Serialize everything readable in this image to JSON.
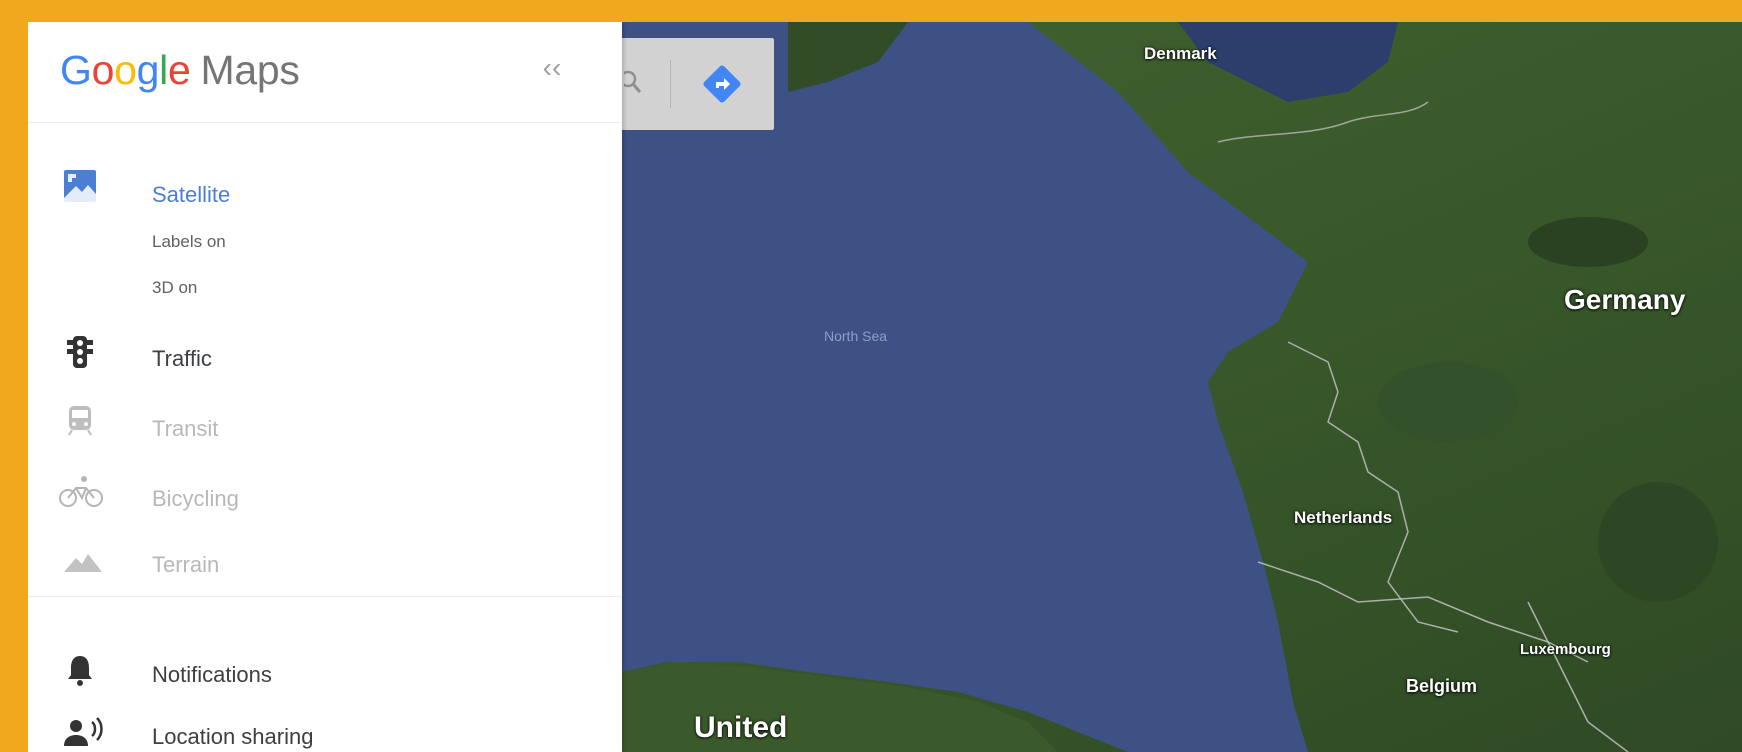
{
  "app": {
    "logo": {
      "letters": [
        "G",
        "o",
        "o",
        "g",
        "l",
        "e"
      ],
      "suffix": "Maps"
    },
    "collapse_label": "‹‹"
  },
  "panel": {
    "satellite": {
      "label": "Satellite",
      "icon": "satellite-icon",
      "options": [
        "Labels on",
        "3D on"
      ]
    },
    "layers": [
      {
        "label": "Traffic",
        "icon": "traffic-light-icon",
        "enabled": true
      },
      {
        "label": "Transit",
        "icon": "train-icon",
        "enabled": false
      },
      {
        "label": "Bicycling",
        "icon": "bicycle-icon",
        "enabled": false
      },
      {
        "label": "Terrain",
        "icon": "terrain-icon",
        "enabled": false
      }
    ],
    "other": [
      {
        "label": "Notifications",
        "icon": "bell-icon"
      },
      {
        "label": "Location sharing",
        "icon": "location-sharing-icon"
      }
    ]
  },
  "searchbox": {
    "search_icon": "search-icon",
    "directions_icon": "directions-icon"
  },
  "map": {
    "labels": {
      "denmark": "Denmark",
      "germany": "Germany",
      "north_sea": "North Sea",
      "netherlands": "Netherlands",
      "belgium": "Belgium",
      "luxembourg": "Luxembourg",
      "united": "United"
    }
  },
  "colors": {
    "frame": "#f2a81e",
    "accent": "#4a7fd4",
    "sea": "#3d5184",
    "land": "#3c5a2c",
    "directions": "#4285f4"
  }
}
